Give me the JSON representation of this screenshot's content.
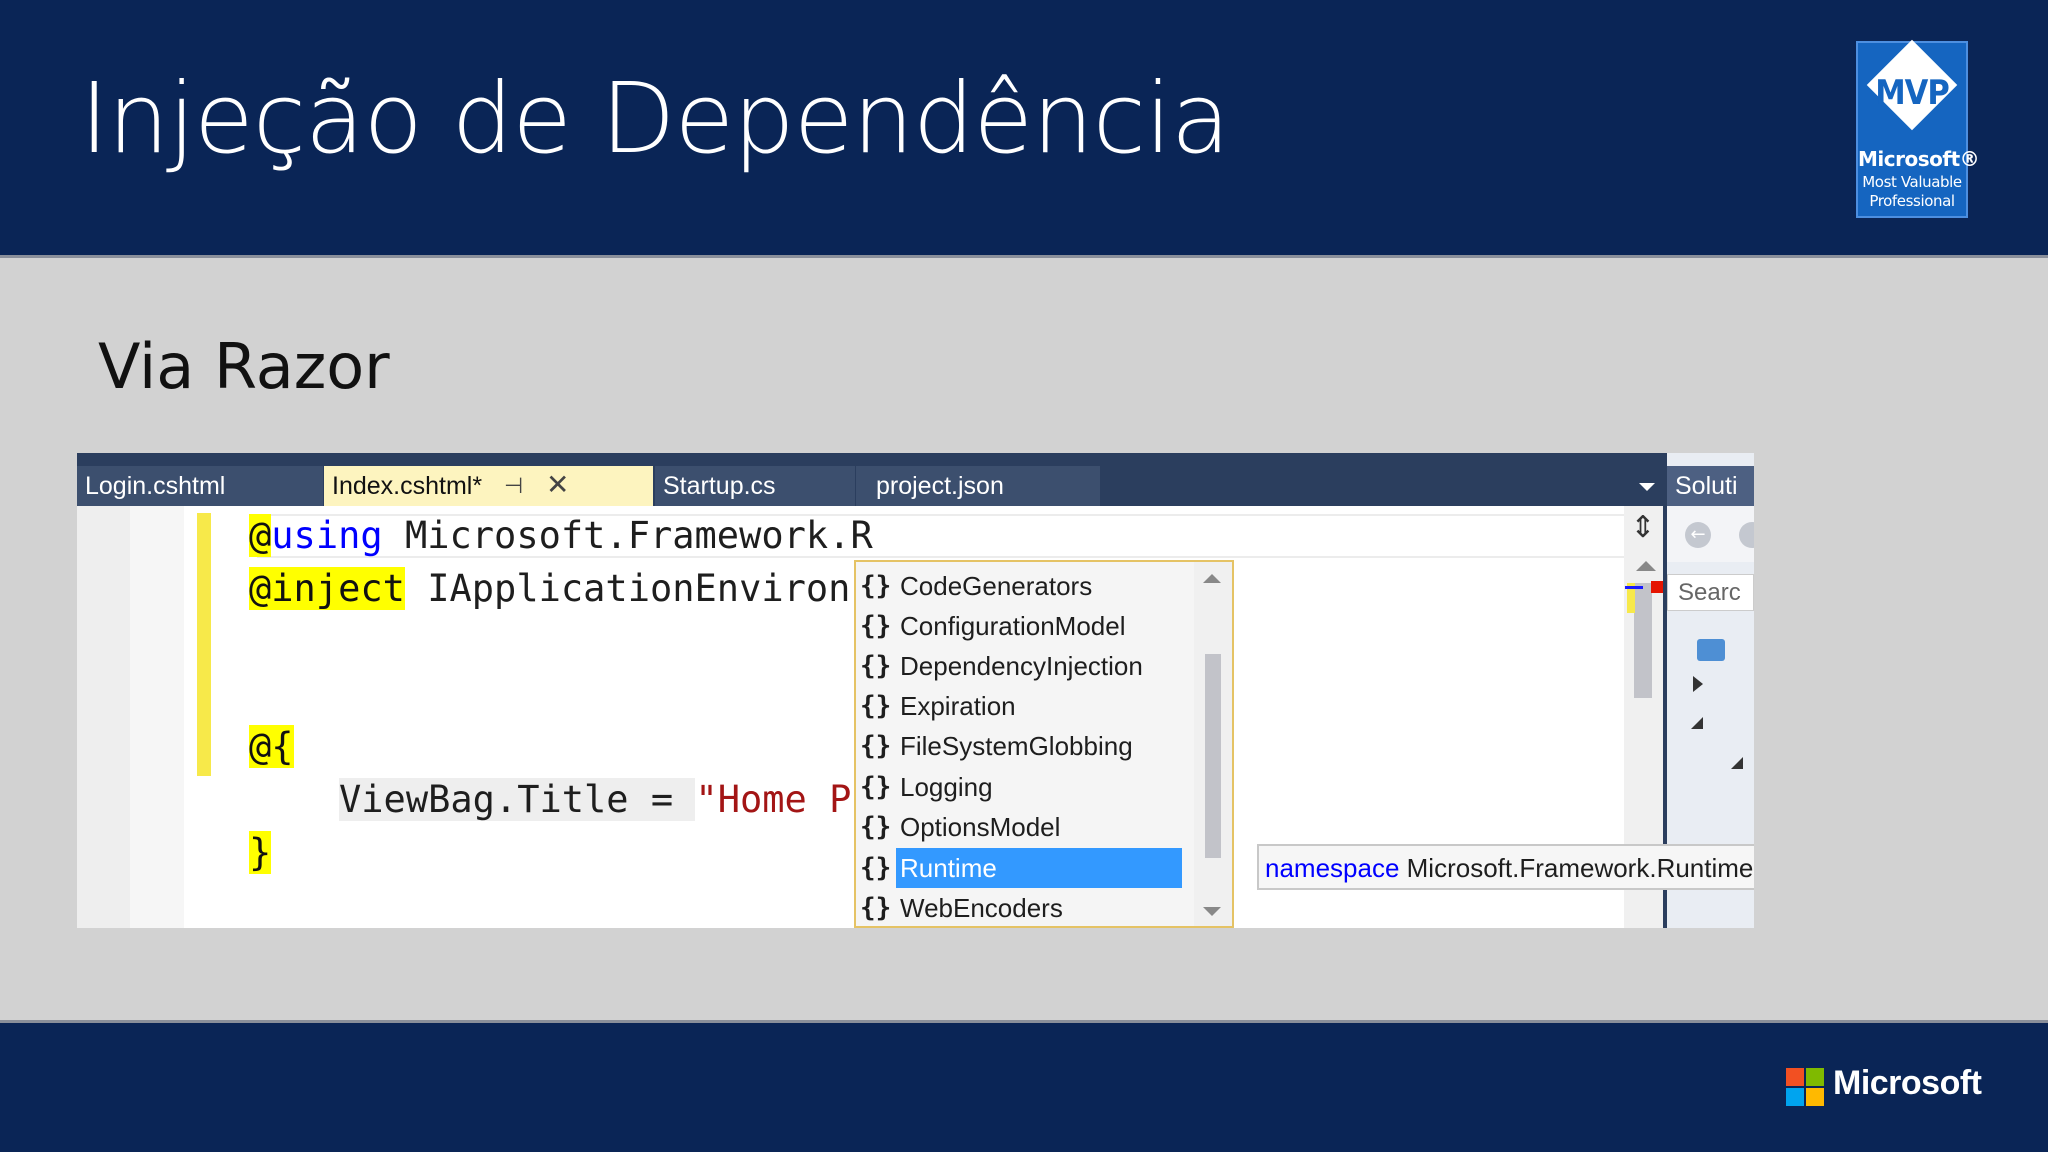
{
  "slide": {
    "title": "Injeção de Dependência",
    "subtitle": "Via Razor"
  },
  "mvp_badge": {
    "logo": "MVP",
    "brand": "Microsoft®",
    "line1": "Most Valuable",
    "line2": "Professional"
  },
  "editor": {
    "tabs": [
      {
        "label": "Login.cshtml",
        "active": false
      },
      {
        "label": "Index.cshtml*",
        "active": true
      },
      {
        "label": "Startup.cs",
        "active": false
      },
      {
        "label": "project.json",
        "active": false
      }
    ],
    "pin_icon": "⊣",
    "close_icon": "✕",
    "code": {
      "line1_razor": "@",
      "line1_kw": "using",
      "line1_rest": " Microsoft.Framework.R",
      "line2_razor": "@inject",
      "line2_rest": " IApplicationEnviron",
      "line3_razor": "@{",
      "line4_code": "ViewBag.Title = ",
      "line4_str": "\"Home P",
      "line5_razor": "}"
    },
    "intellisense": {
      "icon": "{}",
      "items": [
        "CodeGenerators",
        "ConfigurationModel",
        "DependencyInjection",
        "Expiration",
        "FileSystemGlobbing",
        "Logging",
        "OptionsModel",
        "Runtime",
        "WebEncoders"
      ],
      "selected": "Runtime"
    },
    "tooltip": {
      "keyword": "namespace",
      "text": " Microsoft.Framework.Runtime"
    },
    "solution_panel": {
      "header": "Soluti",
      "search_placeholder": "Searc"
    }
  },
  "footer": {
    "brand": "Microsoft",
    "logo_colors": [
      "#f25022",
      "#7fba00",
      "#00a4ef",
      "#ffb900"
    ]
  },
  "colors": {
    "dark_blue": "#0a2556",
    "razor_highlight": "#ffff00",
    "keyword": "#0000ff",
    "string": "#a31515",
    "selection": "#3399ff"
  }
}
